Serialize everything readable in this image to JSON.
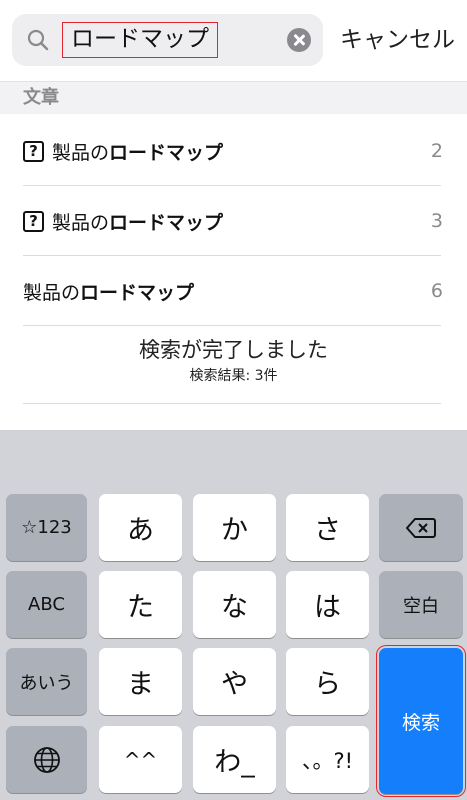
{
  "search": {
    "query": "ロードマップ",
    "cancel_label": "キャンセル"
  },
  "results": {
    "section_label": "文章",
    "rows": [
      {
        "has_icon": true,
        "icon_glyph": "?",
        "prefix": "製品の",
        "keyword": "ロードマップ",
        "count": "2"
      },
      {
        "has_icon": true,
        "icon_glyph": "?",
        "prefix": "製品の",
        "keyword": "ロードマップ",
        "count": "3"
      },
      {
        "has_icon": false,
        "prefix": "製品の",
        "keyword": "ロードマップ",
        "count": "6"
      }
    ],
    "status_main": "検索が完了しました",
    "status_sub": "検索結果: 3件"
  },
  "keyboard": {
    "mode_key": "☆123",
    "abc_key": "ABC",
    "kana_mode_key": "あいう",
    "globe_icon": "globe-icon",
    "delete_icon": "delete-backward-icon",
    "space_label": "空白",
    "search_label": "検索",
    "keys": [
      "あ",
      "か",
      "さ",
      "た",
      "な",
      "は",
      "ま",
      "や",
      "ら",
      "^^",
      "わ_",
      "、。?!"
    ],
    "accent_color": "#147efb"
  }
}
